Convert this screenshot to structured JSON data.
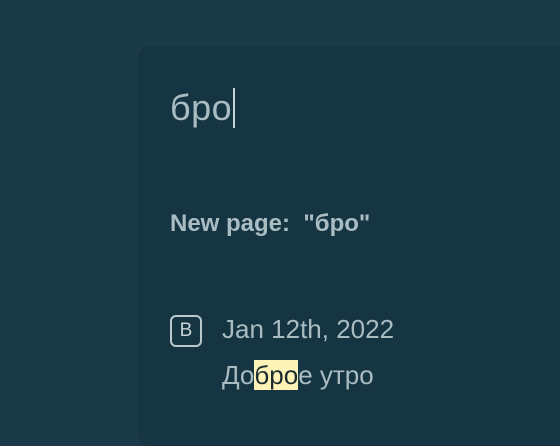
{
  "search": {
    "query": "бро"
  },
  "new_page": {
    "label": "New page:  \"бро\""
  },
  "result": {
    "icon_letter": "B",
    "icon_name": "block-letter-icon",
    "title": "Jan 12th, 2022",
    "snippet_before": "До",
    "snippet_match": "бро",
    "snippet_after": "е утро"
  },
  "colors": {
    "background": "#1b3a47",
    "panel": "#163542",
    "text": "#a9bcc2",
    "highlight": "#fdf3b6"
  }
}
